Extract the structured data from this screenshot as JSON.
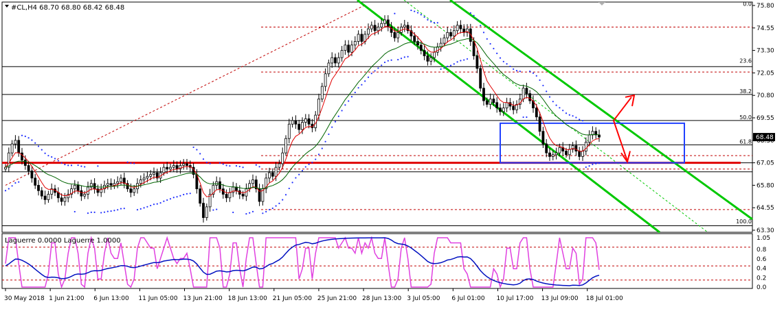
{
  "header": {
    "symbol_text": "#CL,H4  68.70 68.80 68.42 68.48"
  },
  "oscillator": {
    "label": "Laguerre 0.0000  Laguerre 1.0000"
  },
  "colors": {
    "candle": "#000000",
    "red_ma": "#e00000",
    "green_ma": "#006400",
    "channel": "#00c800",
    "zone_box": "#2040ff",
    "sar_dots": "#2030ff",
    "support_line": "#e00000",
    "arrows": "#ff0000",
    "laguerre_fast": "#e040e0",
    "laguerre_slow": "#0010c0",
    "fib_dash": "#c00000"
  },
  "chart_data": [
    {
      "type": "candlestick",
      "title": "#CL,H4  68.70 68.80 68.42 68.48",
      "ohlc_last": {
        "open": 68.7,
        "high": 68.8,
        "low": 68.42,
        "close": 68.48
      },
      "current_price_label": "68.48",
      "ylim": [
        63.3,
        75.8
      ],
      "y_ticks": [
        "75.80",
        "74.55",
        "73.30",
        "72.05",
        "70.80",
        "69.55",
        "68.30",
        "67.05",
        "65.80",
        "64.55",
        "63.30"
      ],
      "y_tick_values": [
        75.8,
        74.55,
        73.3,
        72.05,
        70.8,
        69.55,
        68.3,
        67.05,
        65.8,
        64.55,
        63.3
      ],
      "x_labels": [
        "30 May 2018",
        "1 Jun 21:00",
        "6 Jun 13:00",
        "11 Jun 05:00",
        "13 Jun 21:00",
        "18 Jun 13:00",
        "21 Jun 05:00",
        "25 Jun 21:00",
        "28 Jun 13:00",
        "3 Jul 05:00",
        "6 Jul 01:00",
        "10 Jul 17:00",
        "13 Jul 09:00",
        "18 Jul 01:00"
      ],
      "fibonacci_levels": [
        {
          "label": "0.0",
          "value": 75.7
        },
        {
          "label": "23.6",
          "value": 72.55
        },
        {
          "label": "38.2",
          "value": 70.85
        },
        {
          "label": "50.0",
          "value": 69.4
        },
        {
          "label": "61.8",
          "value": 68.05
        },
        {
          "label": "100.0",
          "value": 63.6
        }
      ],
      "horizontal_lines": [
        72.4,
        70.85,
        69.4,
        68.05,
        67.05,
        66.55,
        63.55
      ],
      "dashed_levels": [
        74.6,
        72.1,
        67.45,
        66.7,
        64.45
      ],
      "support_level": 67.05,
      "zone_box": {
        "x_from_bar": 150,
        "x_to_bar": 198,
        "y_low": 67.05,
        "y_high": 69.25
      },
      "price_series": [
        66.8,
        67.6,
        68.1,
        68.3,
        67.6,
        67.2,
        66.9,
        66.6,
        66.2,
        65.8,
        65.5,
        65.2,
        65.0,
        65.3,
        65.6,
        65.4,
        65.1,
        64.9,
        65.1,
        65.3,
        65.6,
        65.8,
        65.5,
        65.2,
        65.3,
        65.7,
        65.9,
        65.6,
        65.4,
        65.6,
        65.8,
        65.9,
        65.8,
        65.9,
        66.0,
        66.2,
        65.9,
        65.6,
        65.4,
        65.6,
        65.9,
        66.1,
        66.2,
        66.3,
        66.4,
        66.5,
        66.2,
        66.5,
        66.8,
        66.7,
        66.8,
        66.9,
        66.7,
        66.9,
        67.0,
        66.9,
        66.8,
        66.4,
        65.6,
        64.8,
        64.0,
        64.6,
        65.3,
        65.8,
        66.0,
        65.6,
        65.3,
        65.1,
        65.4,
        65.7,
        65.5,
        65.3,
        65.2,
        65.6,
        65.9,
        66.1,
        65.6,
        64.9,
        65.6,
        66.2,
        66.5,
        66.3,
        66.8,
        67.0,
        67.6,
        68.4,
        69.2,
        69.4,
        69.2,
        68.9,
        69.3,
        69.5,
        69.2,
        69.0,
        69.7,
        70.6,
        71.3,
        72.0,
        72.6,
        72.9,
        72.6,
        72.9,
        73.3,
        73.6,
        73.2,
        73.6,
        73.8,
        74.2,
        73.8,
        74.2,
        74.5,
        74.7,
        74.4,
        74.6,
        74.8,
        75.0,
        74.6,
        74.3,
        74.0,
        74.3,
        74.6,
        74.7,
        74.4,
        74.1,
        73.8,
        73.6,
        73.3,
        73.0,
        72.7,
        72.9,
        73.2,
        73.5,
        73.7,
        74.0,
        74.3,
        74.1,
        74.4,
        74.7,
        74.5,
        74.3,
        74.5,
        73.8,
        73.0,
        72.3,
        71.2,
        70.5,
        70.3,
        70.6,
        70.4,
        70.1,
        69.9,
        70.1,
        70.4,
        70.2,
        70.0,
        70.3,
        70.6,
        71.2,
        70.9,
        70.5,
        70.1,
        69.6,
        68.8,
        68.1,
        67.6,
        67.4,
        67.5,
        67.6,
        67.9,
        67.7,
        67.5,
        67.8,
        68.0,
        67.7,
        67.4,
        67.7,
        68.2,
        68.6,
        68.8,
        68.6,
        68.48
      ],
      "laguerre": {
        "ylim": [
          0,
          1.05
        ],
        "y_ticks": [
          "1.05",
          "0.8",
          "0.6",
          "0.4",
          "0.2",
          "0.0"
        ],
        "y_tick_values": [
          1.05,
          0.8,
          0.6,
          0.4,
          0.2,
          0.0
        ],
        "dashed_levels": [
          0.85,
          0.45,
          0.15
        ]
      }
    }
  ]
}
